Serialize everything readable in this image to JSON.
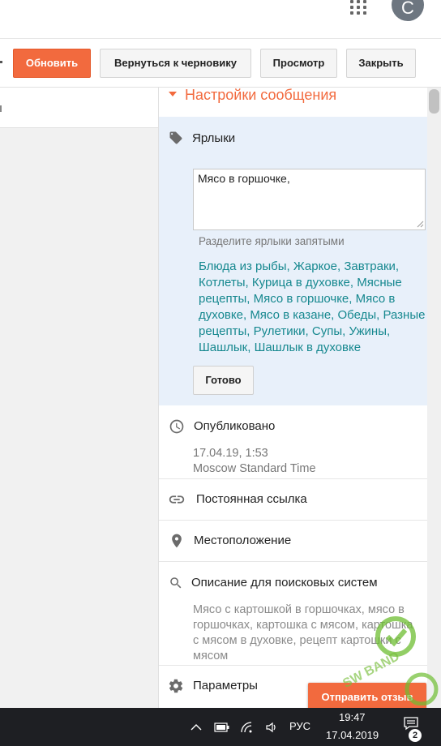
{
  "header": {
    "avatar_letter": "C",
    "apps_icon": "apps-grid-icon"
  },
  "toolbar": {
    "update_label": "Обновить",
    "revert_label": "Вернуться к черновику",
    "preview_label": "Просмотр",
    "close_label": "Закрыть"
  },
  "settings": {
    "title": "Настройки сообщения",
    "labels": {
      "heading": "Ярлыки",
      "icon": "tag-icon",
      "value": "Мясо в горшочке,",
      "hint": "Разделите ярлыки запятыми",
      "suggestions": [
        "Блюда из рыбы",
        "Жаркое",
        "Завтраки",
        "Котлеты",
        "Курица в духовке",
        "Мясные рецепты",
        "Мясо в горшочке",
        "Мясо в духовке",
        "Мясо в казане",
        "Обеды",
        "Разные рецепты",
        "Рулетики",
        "Супы",
        "Ужины",
        "Шашлык",
        "Шашлык в духовке"
      ],
      "done_label": "Готово"
    },
    "published": {
      "heading": "Опубликовано",
      "icon": "clock-icon",
      "date": "17.04.19, 1:53",
      "timezone": "Moscow Standard Time"
    },
    "permalink": {
      "heading": "Постоянная ссылка",
      "icon": "link-icon"
    },
    "location": {
      "heading": "Местоположение",
      "icon": "location-pin-icon"
    },
    "search_description": {
      "heading": "Описание для поисковых систем",
      "icon": "search-icon",
      "text": "Мясо с картошкой в горшочках, мясо в горшочках, картошка с мясом, картошка с мясом в духовке, рецепт картошки с мясом"
    },
    "options": {
      "heading": "Параметры",
      "icon": "gear-icon"
    },
    "send_feedback_label": "Отправить отзыв"
  },
  "taskbar": {
    "language": "РУС",
    "time": "19:47",
    "date": "17.04.2019",
    "notification_count": "2"
  },
  "watermark": {
    "text": "SW BAND"
  },
  "colors": {
    "accent": "#f26a3e",
    "link": "#16888f",
    "labels_bg": "#e8f0fa",
    "taskbar": "#1e1f23"
  }
}
